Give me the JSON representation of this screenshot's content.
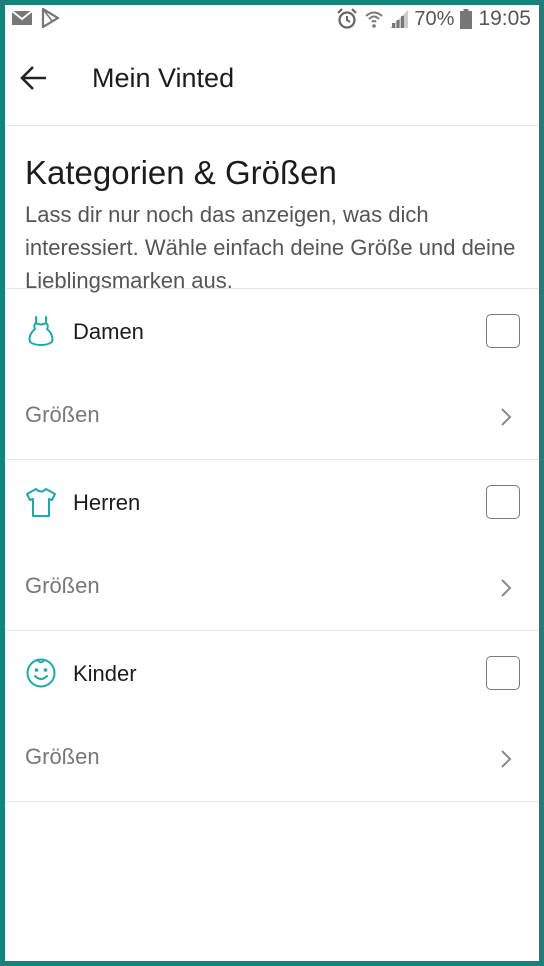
{
  "status_bar": {
    "battery": "70%",
    "time": "19:05",
    "icons": [
      "mail-icon",
      "play-store-icon",
      "alarm-icon",
      "wifi-icon",
      "signal-icon",
      "battery-icon"
    ]
  },
  "app_bar": {
    "title": "Mein Vinted",
    "back_icon": "arrow-left-icon"
  },
  "header": {
    "title": "Kategorien & Größen",
    "description": "Lass dir nur noch das anzeigen, was dich interessiert. Wähle einfach deine Größe und deine Lieblingsmarken aus."
  },
  "categories": [
    {
      "label": "Damen",
      "icon": "dress-icon",
      "checked": false,
      "sizes_label": "Größen"
    },
    {
      "label": "Herren",
      "icon": "tshirt-icon",
      "checked": false,
      "sizes_label": "Größen"
    },
    {
      "label": "Kinder",
      "icon": "smiley-icon",
      "checked": false,
      "sizes_label": "Größen"
    }
  ],
  "colors": {
    "accent": "#1fa9a6",
    "frame": "#1b7f7c"
  }
}
